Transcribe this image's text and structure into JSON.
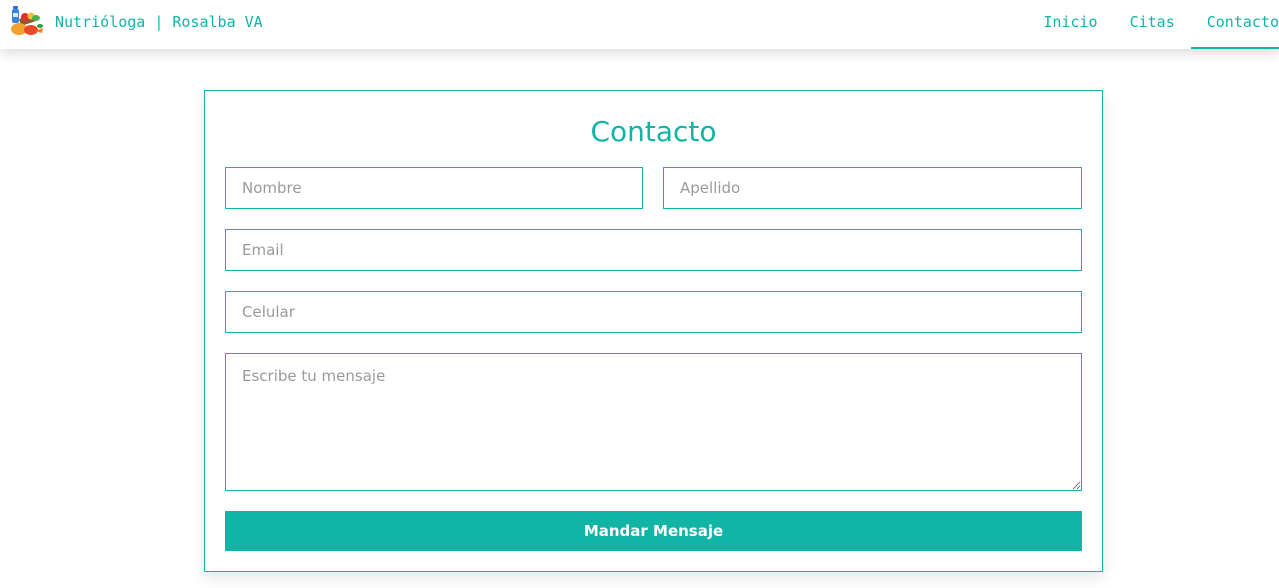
{
  "navbar": {
    "brand": "Nutrióloga | Rosalba VA",
    "links": [
      {
        "label": "Inicio",
        "active": false
      },
      {
        "label": "Citas",
        "active": false
      },
      {
        "label": "Contacto",
        "active": true
      }
    ]
  },
  "form": {
    "title": "Contacto",
    "fields": {
      "first_name": {
        "placeholder": "Nombre",
        "value": ""
      },
      "last_name": {
        "placeholder": "Apellido",
        "value": ""
      },
      "email": {
        "placeholder": "Email",
        "value": ""
      },
      "phone": {
        "placeholder": "Celular",
        "value": ""
      },
      "message": {
        "placeholder": "Escribe tu mensaje",
        "value": ""
      }
    },
    "submit_label": "Mandar Mensaje"
  },
  "colors": {
    "accent": "#12b4a6",
    "placeholder": "#9a9a9a",
    "background": "#ffffff"
  },
  "icons": {
    "logo": "healthy-groceries-logo-icon"
  }
}
